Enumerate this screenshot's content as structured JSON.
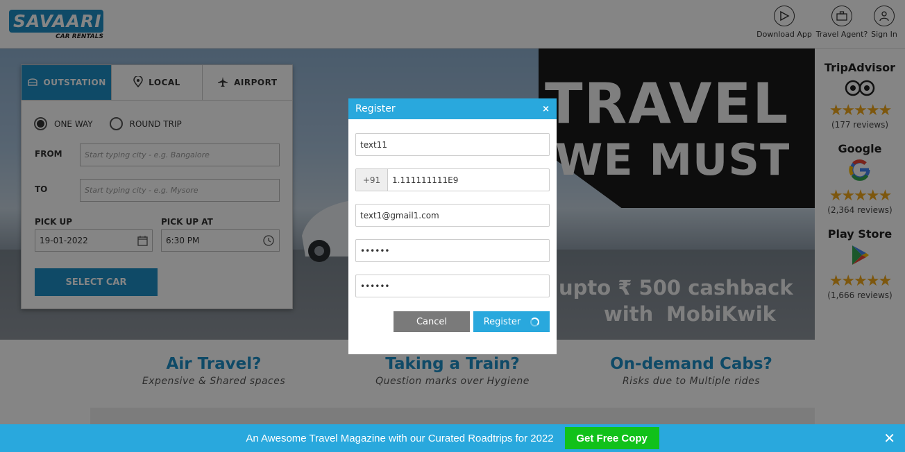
{
  "header": {
    "logo_text": "SAVAARI",
    "logo_sub": "CAR RENTALS",
    "download_app": "Download App",
    "travel_agent": "Travel Agent?",
    "sign_in": "Sign In"
  },
  "widget": {
    "tabs": [
      {
        "label": "OUTSTATION",
        "active": true
      },
      {
        "label": "LOCAL",
        "active": false
      },
      {
        "label": "AIRPORT",
        "active": false
      }
    ],
    "trip_types": [
      {
        "label": "ONE WAY",
        "selected": true
      },
      {
        "label": "ROUND TRIP",
        "selected": false
      }
    ],
    "from_label": "FROM",
    "from_placeholder": "Start typing city - e.g. Bangalore",
    "to_label": "TO",
    "to_placeholder": "Start typing city - e.g. Mysore",
    "pickup_label": "PICK UP",
    "pickup_date": "19-01-2022",
    "pickup_at_label": "PICK UP AT",
    "pickup_time": "6:30 PM",
    "select_car": "SELECT CAR"
  },
  "hero": {
    "line1": "TRAVEL",
    "line2": "WE MUST",
    "promo1": "upto ₹ 500 cashback",
    "promo2": "with",
    "brand": "MobiKwik"
  },
  "reviews": [
    {
      "source": "TripAdvisor",
      "count": "(177 reviews)",
      "rating": 5
    },
    {
      "source": "Google",
      "count": "(2,364 reviews)",
      "rating": 4.5
    },
    {
      "source": "Play Store",
      "count": "(1,666 reviews)",
      "rating": 4.5
    }
  ],
  "features": [
    {
      "title": "Air Travel?",
      "subtitle": "Expensive & Shared spaces"
    },
    {
      "title": "Taking a Train?",
      "subtitle": "Question marks over Hygiene"
    },
    {
      "title": "On-demand Cabs?",
      "subtitle": "Risks due to Multiple rides"
    }
  ],
  "modal": {
    "title": "Register",
    "close": "×",
    "name_value": "text11",
    "country_code": "+91",
    "phone_value": "1.111111111E9",
    "email_value": "text1@gmail1.com",
    "password_value": "••••••",
    "confirm_value": "••••••",
    "cancel": "Cancel",
    "register": "Register"
  },
  "bottom_bar": {
    "text": "An Awesome Travel Magazine with our Curated Roadtrips for 2022",
    "button": "Get Free Copy",
    "close": "✕"
  },
  "colors": {
    "brand_blue": "#1e8fc6",
    "modal_header": "#29a8dd",
    "cancel_gray": "#7a7a7a",
    "cta_green": "#11c11a",
    "star_gold": "#f0a81c"
  }
}
